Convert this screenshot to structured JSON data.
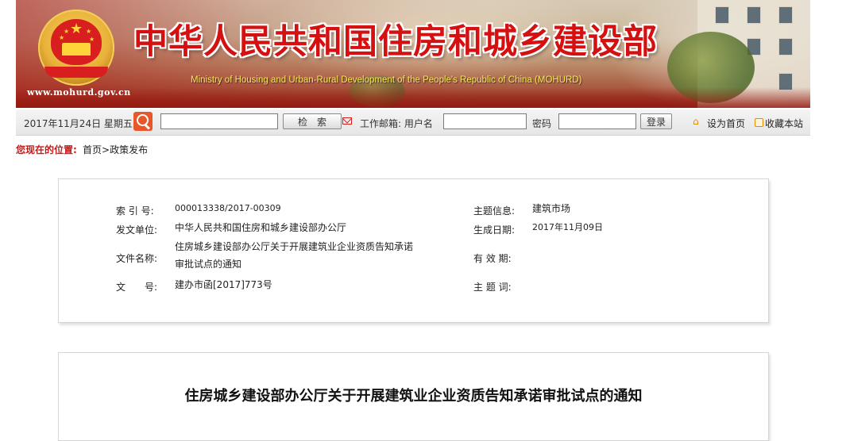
{
  "header": {
    "title_cn": "中华人民共和国住房和城乡建设部",
    "title_en": "Ministry of Housing and Urban-Rural Development of the People's Republic of China (MOHURD)",
    "site_url": "www.mohurd.gov.cn"
  },
  "toolbar": {
    "date": "2017年11月24日  星期五",
    "search_value": "",
    "search_button": "检　索",
    "mail_label": "工作邮箱: 用户名",
    "username_value": "",
    "password_label": "密码",
    "password_value": "",
    "login_button": "登录",
    "set_home": "设为首页",
    "bookmark": "收藏本站"
  },
  "breadcrumb": {
    "prefix": "您现在的位置:",
    "home": "首页",
    "separator": ">",
    "current": "政策发布"
  },
  "info": {
    "index_label": "索 引 号:",
    "index_value": "000013338/2017-00309",
    "theme_label": "主题信息:",
    "theme_value": "建筑市场",
    "issuer_label": "发文单位:",
    "issuer_value": "中华人民共和国住房和城乡建设部办公厅",
    "date_label": "生成日期:",
    "date_value": "2017年11月09日",
    "filename_label": "文件名称:",
    "filename_value": "住房城乡建设部办公厅关于开展建筑业企业资质告知承诺审批试点的通知",
    "validity_label": "有 效 期:",
    "validity_value": "",
    "doc_no_label": "文　　号:",
    "doc_no_value": "建办市函[2017]773号",
    "keywords_label": "主 题 词:",
    "keywords_value": ""
  },
  "article": {
    "title": "住房城乡建设部办公厅关于开展建筑业企业资质告知承诺审批试点的通知"
  }
}
